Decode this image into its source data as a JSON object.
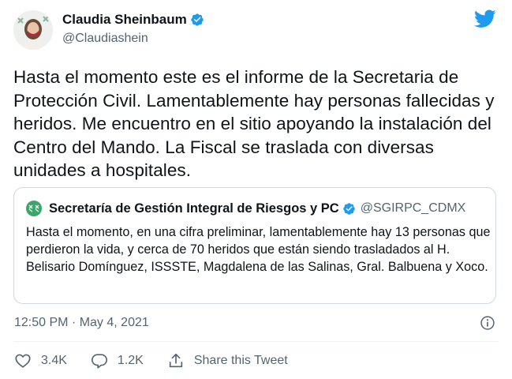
{
  "tweet": {
    "author": {
      "name": "Claudia Sheinbaum",
      "handle": "@Claudiashein"
    },
    "text": "Hasta el momento este es el informe de la Secretaria de Protección Civil. Lamentablemente hay personas fallecidas y heridos. Me encuentro en el sitio apoyando la instalación del Centro del Mando. La Fiscal se traslada con diversas unidades a hospitales.",
    "quoted": {
      "name": "Secretaría de Gestión Integral de Riesgos y PC",
      "handle": "@SGIRPC_CDMX",
      "text": "Hasta el momento, en una cifra preliminar, lamentablemente hay 13 personas que perdieron la vida, y cerca de 70 heridos que están siendo trasladados al H. Belisario Domínguez, ISSSTE, Magdalena de las Salinas, Gral. Balbuena y Xoco."
    },
    "timestamp": "12:50 PM · May 4, 2021",
    "actions": {
      "likes": "3.4K",
      "replies": "1.2K",
      "share_label": "Share this Tweet"
    }
  },
  "colors": {
    "verified": "#1d9bf0",
    "twitter_brand": "#1d9bf0",
    "secondary_text": "#536471",
    "border": "#cfd9de"
  },
  "icons": [
    "avatar",
    "verified-badge-icon",
    "twitter-bird-icon",
    "info-icon",
    "heart-icon",
    "reply-icon",
    "share-icon"
  ]
}
